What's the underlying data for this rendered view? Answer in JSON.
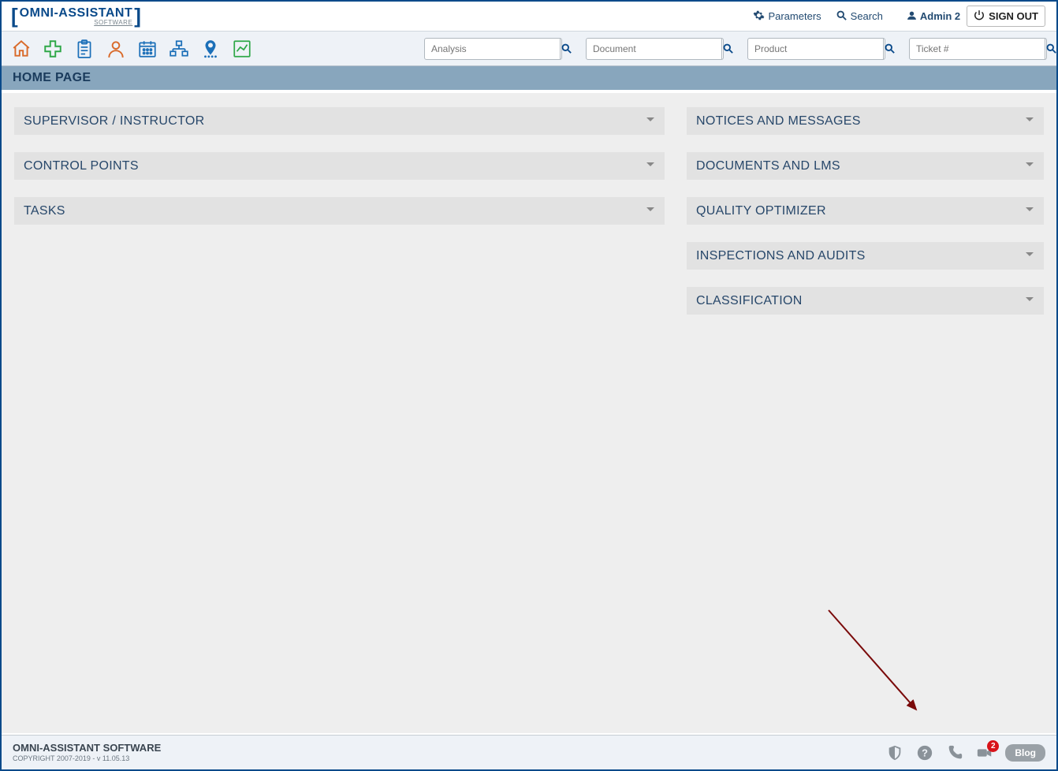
{
  "logo": {
    "main": "OMNI-ASSISTANT",
    "sub": "SOFTWARE"
  },
  "top": {
    "parameters": "Parameters",
    "search": "Search",
    "user": "Admin 2",
    "signout": "SIGN OUT"
  },
  "searchboxes": {
    "analysis": "Analysis",
    "document": "Document",
    "product": "Product",
    "ticket": "Ticket #"
  },
  "pageTitle": "HOME PAGE",
  "panelsLeft": [
    {
      "title": "SUPERVISOR / INSTRUCTOR"
    },
    {
      "title": "CONTROL POINTS"
    },
    {
      "title": "TASKS"
    }
  ],
  "panelsRight": [
    {
      "title": "NOTICES AND MESSAGES"
    },
    {
      "title": "DOCUMENTS AND LMS"
    },
    {
      "title": "QUALITY OPTIMIZER"
    },
    {
      "title": "INSPECTIONS AND AUDITS"
    },
    {
      "title": "CLASSIFICATION"
    }
  ],
  "footer": {
    "name": "OMNI-ASSISTANT SOFTWARE",
    "copyright": "COPYRIGHT 2007-2019 -  v 11.05.13",
    "blog": "Blog",
    "badge": "2"
  }
}
